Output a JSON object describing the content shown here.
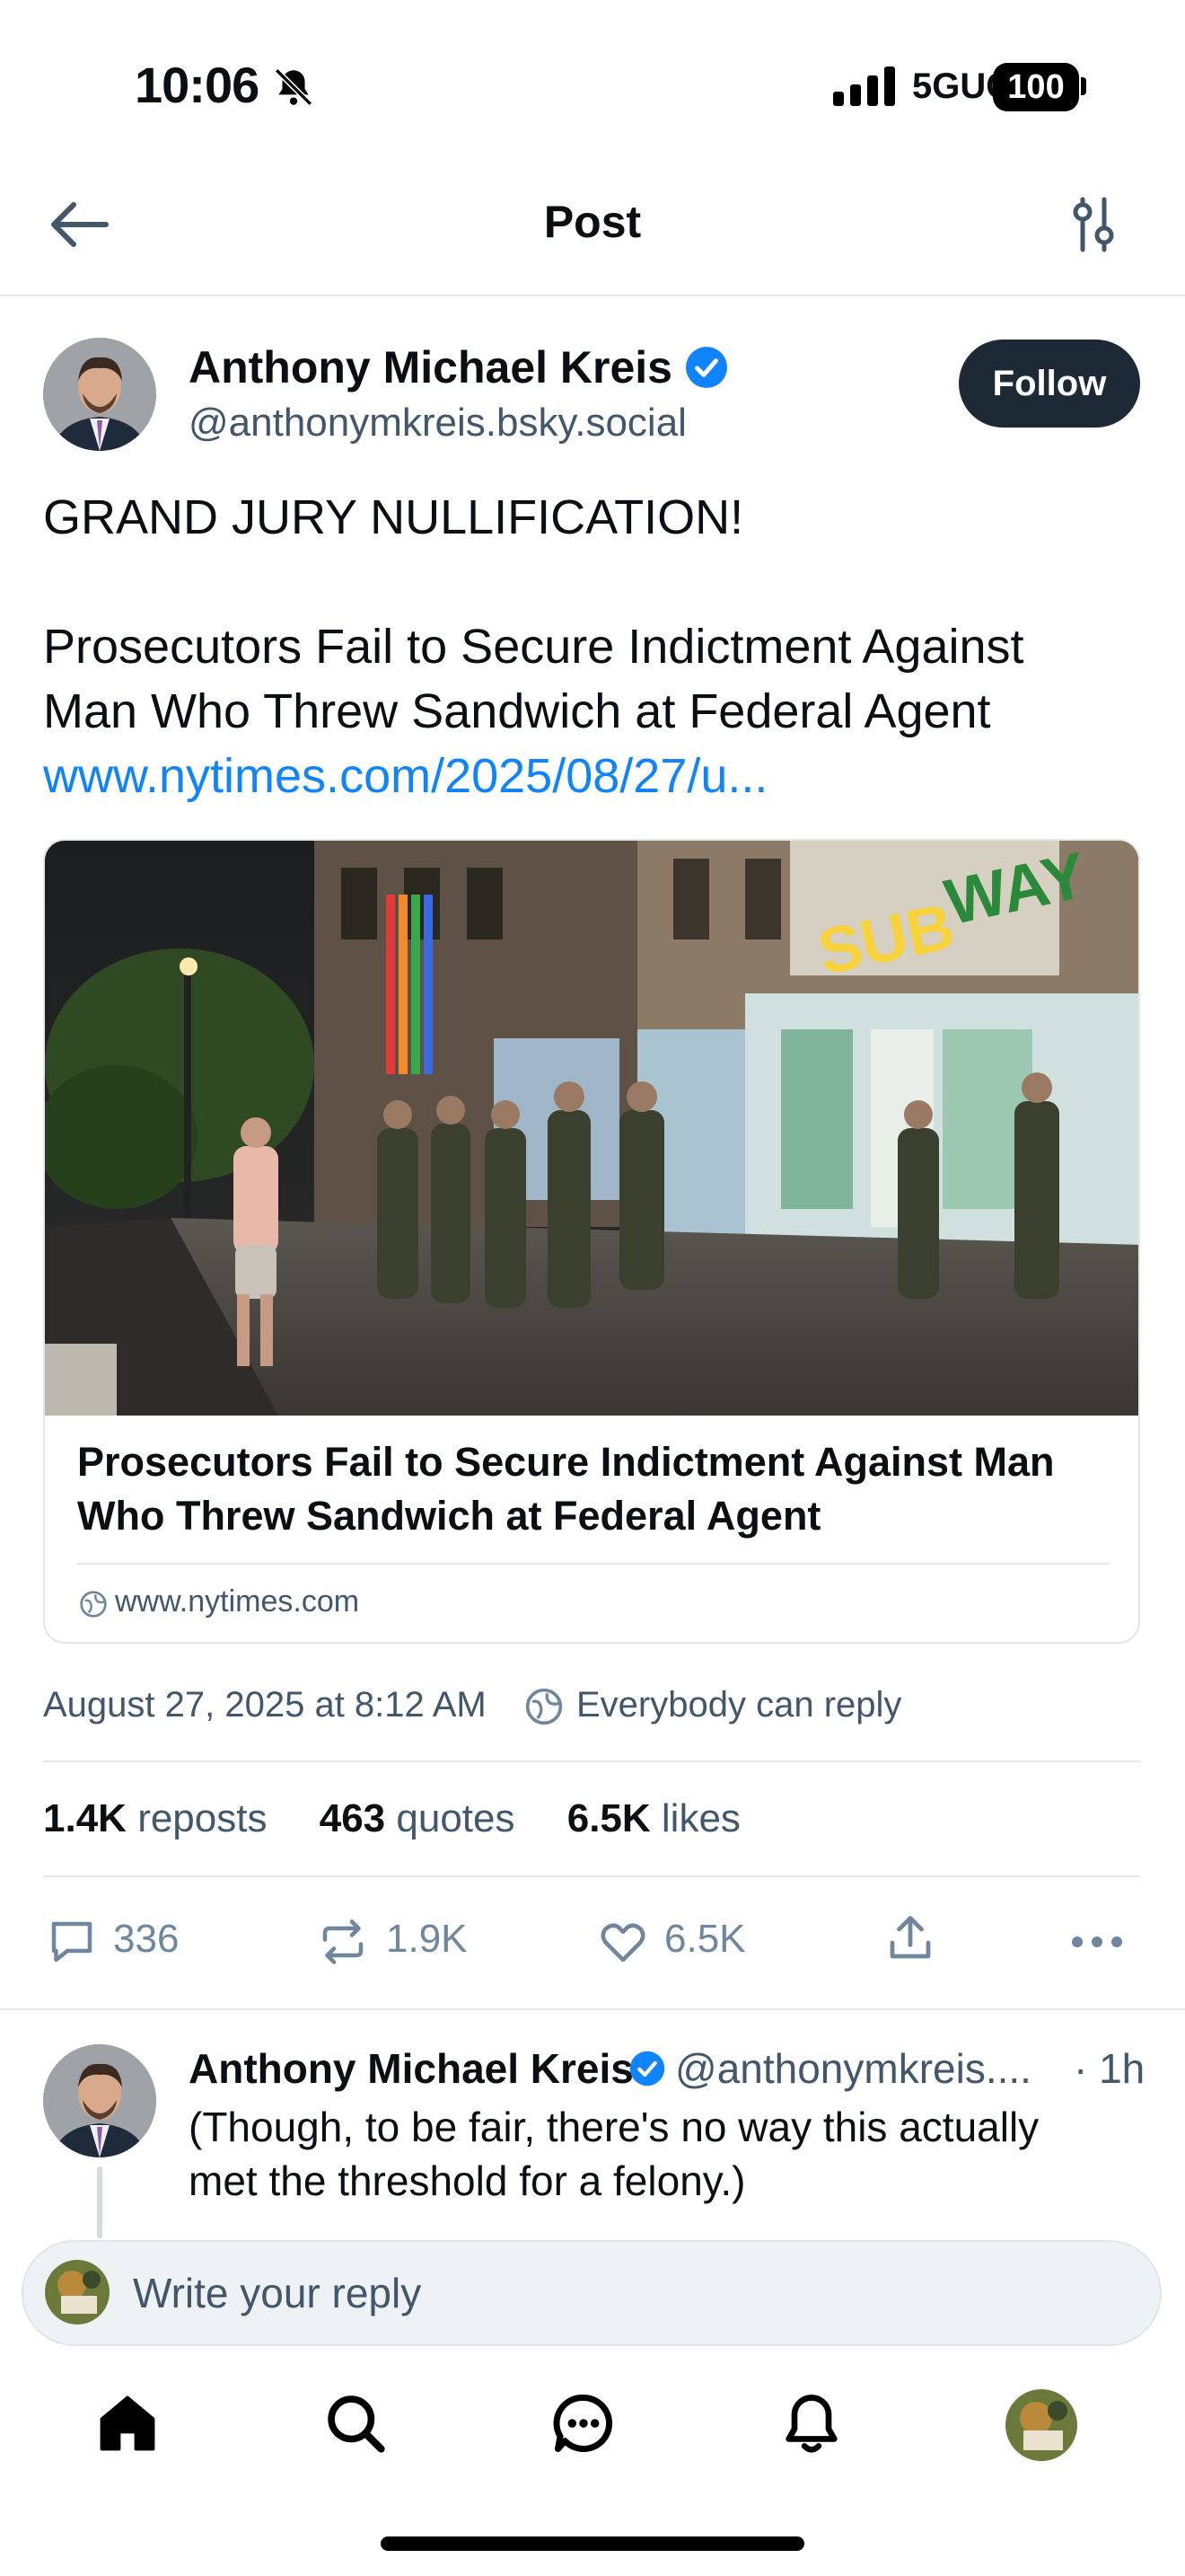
{
  "status_bar": {
    "time": "10:06",
    "network": "5GUC",
    "battery": "100"
  },
  "header": {
    "title": "Post"
  },
  "post": {
    "author_name": "Anthony Michael Kreis",
    "author_handle": "@anthonymkreis.bsky.social",
    "follow_label": "Follow",
    "text_lines": [
      "GRAND JURY NULLIFICATION!",
      "Prosecutors Fail to Secure Indictment Against",
      "Man Who Threw Sandwich at Federal Agent"
    ],
    "link_text": "www.nytimes.com/2025/08/27/u...",
    "card": {
      "title": "Prosecutors Fail to Secure Indictment Against Man Who Threw Sandwich at Federal Agent",
      "domain": "www.nytimes.com",
      "image_sign_text": "SUBWAY"
    },
    "date": "August 27, 2025 at 8:12 AM",
    "reply_setting": "Everybody can reply",
    "stats": [
      {
        "value": "1.4K",
        "label": "reposts"
      },
      {
        "value": "463",
        "label": "quotes"
      },
      {
        "value": "6.5K",
        "label": "likes"
      }
    ],
    "actions": {
      "replies": "336",
      "reposts": "1.9K",
      "likes": "6.5K"
    }
  },
  "reply": {
    "author_name": "Anthony Michael Kreis",
    "author_handle": "@anthonymkreis....",
    "time": "· 1h",
    "text_lines": [
      "(Though, to be fair, there's no way this actually",
      "met the threshold for a felony.)"
    ]
  },
  "composer": {
    "placeholder": "Write your reply"
  },
  "colors": {
    "link": "#1083fe",
    "verified": "#1083fe",
    "follow_button": "#1e2936",
    "muted_text": "#42576c",
    "action_icon": "#6f869f"
  },
  "icons": [
    "back-arrow-icon",
    "filter-icon",
    "verified-icon",
    "globe-icon",
    "reply-icon",
    "repost-icon",
    "heart-icon",
    "share-icon",
    "more-icon",
    "home-icon",
    "search-icon",
    "chat-icon",
    "bell-icon"
  ]
}
